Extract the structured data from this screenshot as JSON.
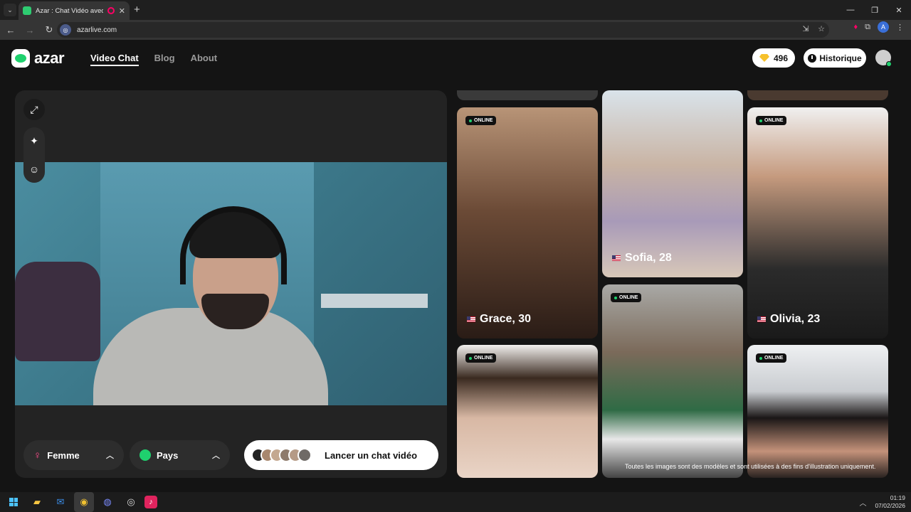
{
  "browser": {
    "tab_title": "Azar : Chat Vidéo avec de n",
    "url": "azarlive.com",
    "site_icon_letter": "◎",
    "profile_letter": "A"
  },
  "header": {
    "logo": "azar",
    "nav": [
      {
        "label": "Video Chat",
        "active": true
      },
      {
        "label": "Blog",
        "active": false
      },
      {
        "label": "About",
        "active": false
      }
    ],
    "gems": "496",
    "history_label": "Historique"
  },
  "controls": {
    "gender_label": "Femme",
    "country_label": "Pays",
    "start_label": "Lancer un chat vidéo"
  },
  "gallery": {
    "online_label": "ONLINE",
    "cards": [
      {
        "name": "Grace, 30",
        "online": true
      },
      {
        "name": "Sofia, 28",
        "online": false
      },
      {
        "name": "Olivia, 23",
        "online": true
      },
      {
        "name": "",
        "online": true
      },
      {
        "name": "",
        "online": true
      },
      {
        "name": "",
        "online": true
      }
    ],
    "disclaimer": "Toutes les images sont des modèles et sont utilisées à des fins d'illustration uniquement."
  },
  "taskbar": {
    "time": "01:19",
    "date": "07/02/2026"
  },
  "colors": {
    "brand_green": "#1fd16e",
    "gem_yellow": "#f6c12c",
    "female_pink": "#ff4d8d"
  }
}
